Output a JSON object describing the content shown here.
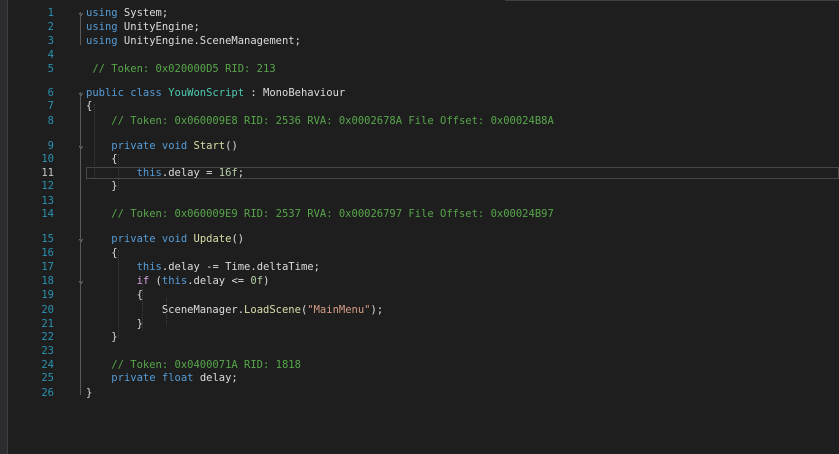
{
  "editor": {
    "current_line": 11,
    "lines": [
      {
        "n": "1",
        "fold": "⌄",
        "tokens": [
          {
            "t": "kw",
            "v": "using"
          },
          {
            "t": "ident",
            "v": " System;"
          }
        ]
      },
      {
        "n": "2",
        "fold": "",
        "tokens": [
          {
            "t": "kw",
            "v": "using"
          },
          {
            "t": "ident",
            "v": " UnityEngine;"
          }
        ]
      },
      {
        "n": "3",
        "fold": "",
        "tokens": [
          {
            "t": "kw",
            "v": "using"
          },
          {
            "t": "ident",
            "v": " UnityEngine.SceneManagement;"
          }
        ]
      },
      {
        "n": "4",
        "fold": "",
        "tokens": []
      },
      {
        "n": "5",
        "fold": "",
        "tokens": [
          {
            "t": "cm",
            "v": " // Token: 0x020000D5 RID: 213"
          }
        ]
      },
      {
        "n": "6",
        "fold": "⌄",
        "tokens": [
          {
            "t": "kw",
            "v": "public"
          },
          {
            "t": "ident",
            "v": " "
          },
          {
            "t": "kw",
            "v": "class"
          },
          {
            "t": "ident",
            "v": " "
          },
          {
            "t": "type",
            "v": "YouWonScript"
          },
          {
            "t": "ident",
            "v": " : MonoBehaviour"
          }
        ]
      },
      {
        "n": "7",
        "fold": "",
        "tokens": [
          {
            "t": "ident",
            "v": "{"
          }
        ]
      },
      {
        "n": "8",
        "fold": "",
        "tokens": [
          {
            "t": "cm",
            "v": "    // Token: 0x060009E8 RID: 2536 RVA: 0x0002678A File Offset: 0x00024B8A"
          }
        ]
      },
      {
        "n": "9",
        "fold": "⌄",
        "tokens": [
          {
            "t": "ident",
            "v": "    "
          },
          {
            "t": "kw",
            "v": "private"
          },
          {
            "t": "ident",
            "v": " "
          },
          {
            "t": "kw",
            "v": "void"
          },
          {
            "t": "ident",
            "v": " "
          },
          {
            "t": "method",
            "v": "Start"
          },
          {
            "t": "ident",
            "v": "()"
          }
        ]
      },
      {
        "n": "10",
        "fold": "",
        "tokens": [
          {
            "t": "ident",
            "v": "    {"
          }
        ]
      },
      {
        "n": "11",
        "fold": "",
        "tokens": [
          {
            "t": "ident",
            "v": "        "
          },
          {
            "t": "kw",
            "v": "this"
          },
          {
            "t": "ident",
            "v": ".delay = "
          },
          {
            "t": "num",
            "v": "16f"
          },
          {
            "t": "ident",
            "v": ";"
          }
        ]
      },
      {
        "n": "12",
        "fold": "",
        "tokens": [
          {
            "t": "ident",
            "v": "    }"
          }
        ]
      },
      {
        "n": "13",
        "fold": "",
        "tokens": []
      },
      {
        "n": "14",
        "fold": "",
        "tokens": [
          {
            "t": "cm",
            "v": "    // Token: 0x060009E9 RID: 2537 RVA: 0x00026797 File Offset: 0x00024B97"
          }
        ]
      },
      {
        "n": "15",
        "fold": "⌄",
        "tokens": [
          {
            "t": "ident",
            "v": "    "
          },
          {
            "t": "kw",
            "v": "private"
          },
          {
            "t": "ident",
            "v": " "
          },
          {
            "t": "kw",
            "v": "void"
          },
          {
            "t": "ident",
            "v": " "
          },
          {
            "t": "method",
            "v": "Update"
          },
          {
            "t": "ident",
            "v": "()"
          }
        ]
      },
      {
        "n": "16",
        "fold": "",
        "tokens": [
          {
            "t": "ident",
            "v": "    {"
          }
        ]
      },
      {
        "n": "17",
        "fold": "",
        "tokens": [
          {
            "t": "ident",
            "v": "        "
          },
          {
            "t": "kw",
            "v": "this"
          },
          {
            "t": "ident",
            "v": ".delay -= Time.deltaTime;"
          }
        ]
      },
      {
        "n": "18",
        "fold": "⌄",
        "tokens": [
          {
            "t": "ident",
            "v": "        "
          },
          {
            "t": "ctrl",
            "v": "if"
          },
          {
            "t": "ident",
            "v": " ("
          },
          {
            "t": "kw",
            "v": "this"
          },
          {
            "t": "ident",
            "v": ".delay <= "
          },
          {
            "t": "num",
            "v": "0f"
          },
          {
            "t": "ident",
            "v": ")"
          }
        ]
      },
      {
        "n": "19",
        "fold": "",
        "tokens": [
          {
            "t": "ident",
            "v": "        {"
          }
        ]
      },
      {
        "n": "20",
        "fold": "",
        "tokens": [
          {
            "t": "ident",
            "v": "            SceneManager."
          },
          {
            "t": "method",
            "v": "LoadScene"
          },
          {
            "t": "ident",
            "v": "("
          },
          {
            "t": "str",
            "v": "\"MainMenu\""
          },
          {
            "t": "ident",
            "v": ");"
          }
        ]
      },
      {
        "n": "21",
        "fold": "",
        "tokens": [
          {
            "t": "ident",
            "v": "        }"
          }
        ]
      },
      {
        "n": "22",
        "fold": "",
        "tokens": [
          {
            "t": "ident",
            "v": "    }"
          }
        ]
      },
      {
        "n": "23",
        "fold": "",
        "tokens": []
      },
      {
        "n": "24",
        "fold": "",
        "tokens": [
          {
            "t": "cm",
            "v": "    // Token: 0x0400071A RID: 1818"
          }
        ]
      },
      {
        "n": "25",
        "fold": "",
        "tokens": [
          {
            "t": "ident",
            "v": "    "
          },
          {
            "t": "kw",
            "v": "private"
          },
          {
            "t": "ident",
            "v": " "
          },
          {
            "t": "kw",
            "v": "float"
          },
          {
            "t": "ident",
            "v": " delay;"
          }
        ]
      },
      {
        "n": "26",
        "fold": "",
        "tokens": [
          {
            "t": "ident",
            "v": "}"
          }
        ]
      }
    ]
  }
}
